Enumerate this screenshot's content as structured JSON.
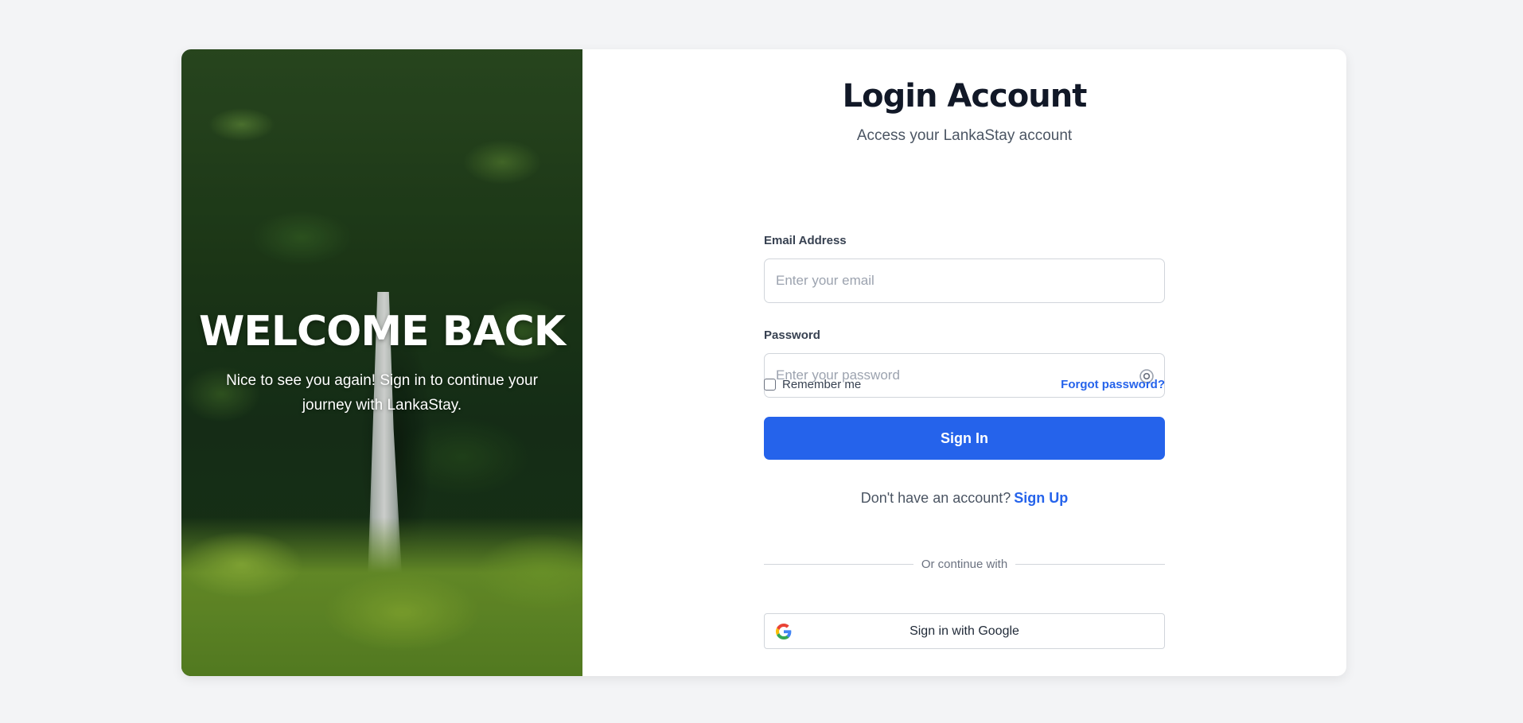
{
  "hero": {
    "title": "WELCOME BACK",
    "subtitle": "Nice to see you again! Sign in to continue your journey with LankaStay."
  },
  "form": {
    "title": "Login Account",
    "subtitle": "Access your LankaStay account",
    "email": {
      "label": "Email Address",
      "placeholder": "Enter your email",
      "value": ""
    },
    "password": {
      "label": "Password",
      "placeholder": "Enter your password",
      "value": "",
      "toggle_icon": "eye-icon"
    },
    "remember_me": {
      "label": "Remember me",
      "checked": false
    },
    "forgot_password": "Forgot password?",
    "submit_label": "Sign In",
    "signup_prompt": "Don't have an account?",
    "signup_link": "Sign Up",
    "divider_text": "Or continue with",
    "google_label": "Sign in with Google"
  },
  "colors": {
    "accent": "#2563eb",
    "heading": "#111827",
    "page_bg": "#f3f4f6"
  }
}
